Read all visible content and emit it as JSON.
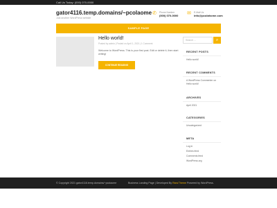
{
  "topbar": {
    "call_text": "Call Us Today: (000) 070-0000"
  },
  "site": {
    "title": "gator4116.temp.domains/~pcolaome",
    "tagline": "Just another WordPress website"
  },
  "contact": {
    "phone": {
      "label": "Phone Number",
      "value": "(000) 070-0000",
      "icon": "phone-icon"
    },
    "email": {
      "label": "E-Mail Us",
      "value": "info@pcolahome.com",
      "icon": "mail-icon"
    }
  },
  "nav": {
    "item": "SAMPLE PAGE"
  },
  "post": {
    "title": "Hello world!",
    "meta": "Posted by admin | Posted on April 1, 2021 | 1 Comment",
    "excerpt": "Welcome to WordPress. This is your first post. Edit or delete it, then start writing!",
    "button": "CONTINUE READING"
  },
  "sidebar": {
    "search_placeholder": "Search ...",
    "search_icon": "search-icon",
    "recent_posts": {
      "title": "RECENT POSTS",
      "items": [
        "Hello world!"
      ]
    },
    "recent_comments": {
      "title": "RECENT COMMENTS",
      "items": [
        "A WordPress Commenter on",
        "Hello world!"
      ]
    },
    "archives": {
      "title": "ARCHIVES",
      "items": [
        "April 2021"
      ]
    },
    "categories": {
      "title": "CATEGORIES",
      "items": [
        "Uncategorized"
      ]
    },
    "meta": {
      "title": "META",
      "items": [
        "Log in",
        "Entries feed",
        "Comments feed",
        "WordPress.org"
      ]
    }
  },
  "footer": {
    "copyright": "© Copyright 2021  gator4116.temp.domains/~pcolaome",
    "credits_prefix": "Business Landing Page | Developed By",
    "credits_author": "Rara Theme",
    "credits_suffix": "Powered by WordPress."
  },
  "colors": {
    "accent": "#f5b400",
    "dark": "#1f1f1f"
  }
}
